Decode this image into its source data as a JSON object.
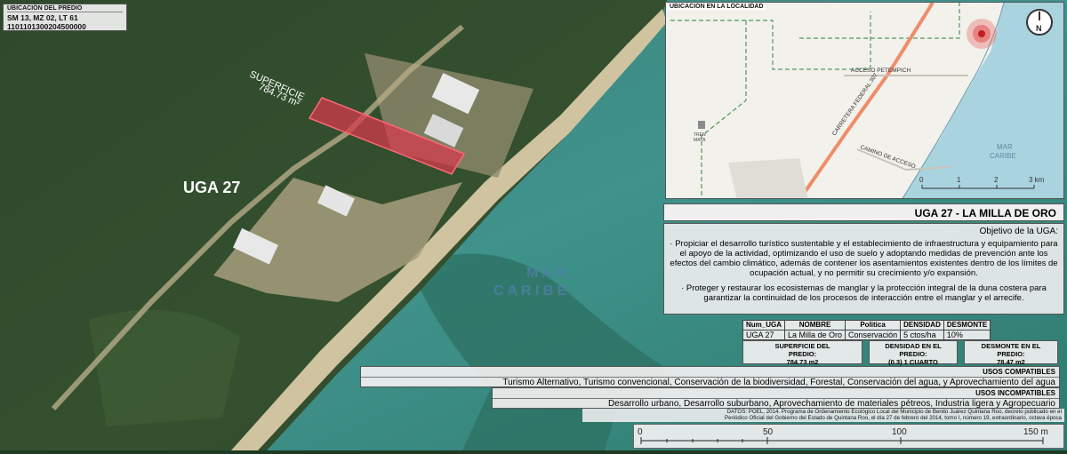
{
  "predio": {
    "header": "UBICACIÓN DEL PREDIO",
    "clave": "SM 13, MZ 02, LT 61",
    "catastral": "1101101300204500000"
  },
  "aerial": {
    "uga_label": "UGA 27",
    "superficie_label": "SUPERFICIE",
    "superficie_value": "784.73 m²",
    "mar_line1": "M A R",
    "mar_line2": "C A R I B E"
  },
  "localidad": {
    "header": "UBICACIÓN EN LA LOCALIDAD",
    "road_petempich": "ACCESO PETEMPICH",
    "road_federal": "CARRETERA FEDERAL 307",
    "road_acceso": "CAMINO DE ACCESO",
    "tren_line1": "TREN",
    "tren_line2": "MAYA",
    "mar_line1": "MAR",
    "mar_line2": "CARIBE",
    "north": "N",
    "scale_ticks": [
      "0",
      "1",
      "2",
      "3 km"
    ]
  },
  "uga": {
    "title": "UGA 27 - LA MILLA DE ORO",
    "objetivo_title": "Objetivo de la UGA:",
    "objetivo_p1": "· Propiciar el desarrollo turístico sustentable y el establecimiento de infraestructura y equipamiento para el apoyo de la actividad, optimizando el uso de suelo y adoptando medidas de prevención ante los efectos del cambio climático, además de contener los asentamientos existentes dentro de los límites de ocupación actual, y no permitir su crecimiento y/o expansión.",
    "objetivo_p2": "· Proteger y restaurar los ecosistemas de manglar y la protección integral de la duna costera para garantizar la continuidad de los procesos de interacción entre el manglar y el arrecife."
  },
  "tabla": {
    "headers": [
      "Num_UGA",
      "NOMBRE",
      "Politica",
      "DENSIDAD",
      "DESMONTE"
    ],
    "row": [
      "UGA 27",
      "La Milla de Oro",
      "Conservación",
      "5 ctos/ha",
      "10%"
    ]
  },
  "stats": {
    "superficie_t1": "SUPERFICIE DEL",
    "superficie_t2": "PREDIO:",
    "superficie_v": "784.73 m2",
    "densidad_t1": "DENSIDAD EN EL",
    "densidad_t2": "PREDIO:",
    "densidad_v": "(0.3) 1 CUARTO",
    "desmonte_t1": "DESMONTE EN EL",
    "desmonte_t2": "PREDIO:",
    "desmonte_v": "78.47 m2"
  },
  "usos": {
    "compatibles_h": "USOS COMPATIBLES",
    "compatibles": "Turismo Alternativo, Turismo convencional, Conservación de la biodiversidad, Forestal, Conservación del agua, y Aprovechamiento del agua",
    "incompatibles_h": "USOS INCOMPATIBLES",
    "incompatibles": "Desarrollo urbano, Desarrollo suburbano, Aprovechamiento de materiales pétreos, Industria ligera y Agropecuario"
  },
  "datos": {
    "line1": "DATOS: POEL, 2014. Programa de Ordenamiento Ecológico Local del Municipio de Benito Juárez Quintana Roo, decreto publicado en el",
    "line2": "Periódico Oficial del Gobierno del Estado de Quintana Roo, el día 27 de febrero del 2014, tomo I, número 19, extraordinario, octava época"
  },
  "scale": {
    "ticks": [
      "0",
      "50",
      "100",
      "150 m"
    ]
  },
  "colors": {
    "parcel": "#d9394b",
    "sea": "#3f8f8a",
    "vegetation": "#33502e",
    "beach": "#cfc3a0"
  }
}
